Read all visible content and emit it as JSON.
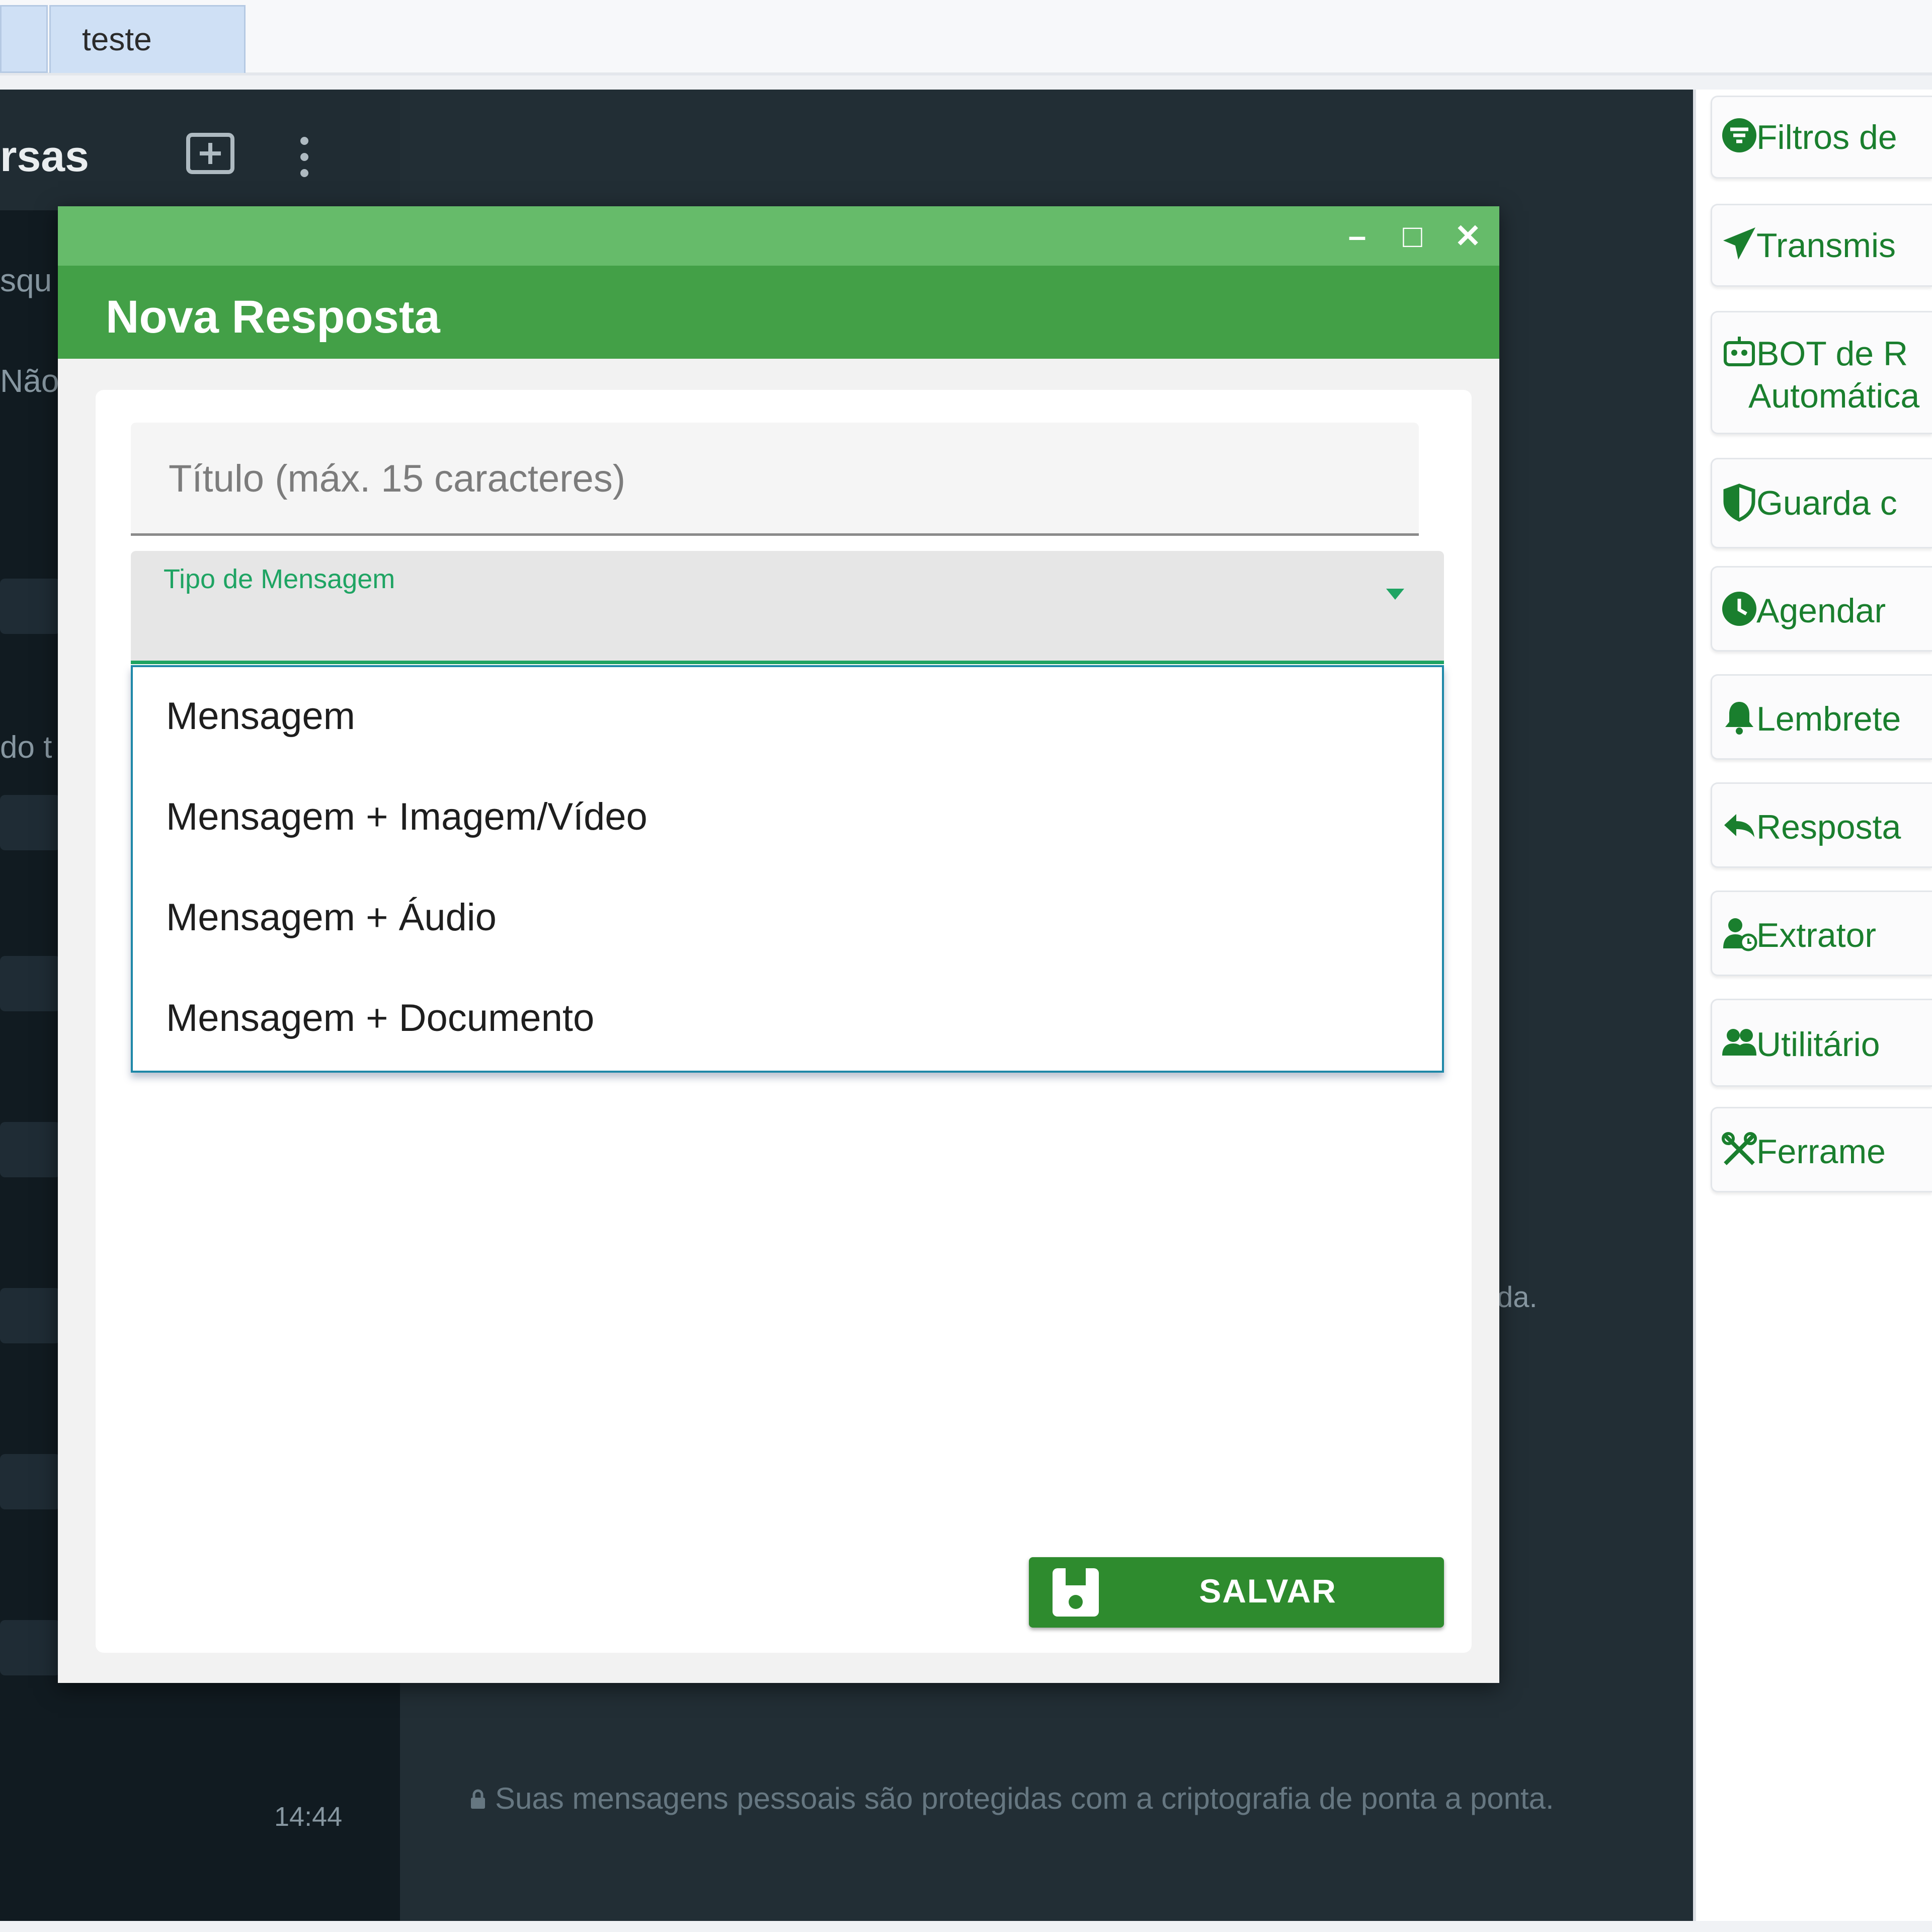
{
  "tabs": [
    {
      "label": "teste"
    }
  ],
  "chat_list": {
    "title_fragment": "rsas",
    "search_fragment": "squ",
    "filter_fragment": "Não",
    "archived_fragment": "do t",
    "time": "14:44"
  },
  "chat_area": {
    "fragment": "da.",
    "encryption_notice": "Suas mensagens pessoais são protegidas com a criptografia de ponta a ponta."
  },
  "side_panel": {
    "items": [
      {
        "label": "Filtros de",
        "icon": "filter-icon"
      },
      {
        "label": "Transmis",
        "icon": "send-icon"
      },
      {
        "label": "BOT de R",
        "label2": "Automática",
        "icon": "robot-icon"
      },
      {
        "label": "Guarda c",
        "icon": "shield-icon"
      },
      {
        "label": "Agendar",
        "icon": "clock-icon"
      },
      {
        "label": "Lembrete",
        "icon": "bell-icon"
      },
      {
        "label": "Resposta",
        "icon": "reply-icon"
      },
      {
        "label": "Extrator",
        "icon": "user-clock-icon"
      },
      {
        "label": "Utilitário",
        "icon": "users-icon"
      },
      {
        "label": "Ferrame",
        "icon": "tools-icon"
      }
    ]
  },
  "modal": {
    "title": "Nova Resposta",
    "window_buttons": {
      "minimize": "–",
      "maximize": "□",
      "close": "✕"
    },
    "title_field": {
      "placeholder": "Título (máx. 15 caracteres)"
    },
    "type_select": {
      "label": "Tipo de Mensagem",
      "options": [
        "Mensagem",
        "Mensagem + Imagem/Vídeo",
        "Mensagem + Áudio",
        "Mensagem + Documento"
      ]
    },
    "save_button": {
      "label": "SALVAR",
      "icon": "save-icon"
    }
  },
  "colors": {
    "accent": "#43a047",
    "titlebar": "#66bb6a",
    "focus": "#1fa463",
    "panel_text": "#1a7f2e"
  }
}
